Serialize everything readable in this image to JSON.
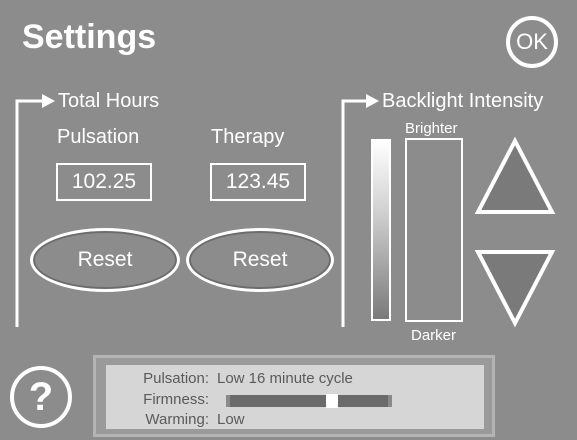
{
  "header": {
    "title": "Settings",
    "ok_label": "OK"
  },
  "total_hours": {
    "label": "Total Hours",
    "pulsation": {
      "label": "Pulsation",
      "value": "102.25",
      "reset_label": "Reset"
    },
    "therapy": {
      "label": "Therapy",
      "value": "123.45",
      "reset_label": "Reset"
    }
  },
  "backlight": {
    "label": "Backlight Intensity",
    "brighter_label": "Brighter",
    "darker_label": "Darker"
  },
  "help": {
    "label": "?"
  },
  "status": {
    "pulsation_key": "Pulsation:",
    "pulsation_value": "Low  16 minute cycle",
    "firmness_key": "Firmness:",
    "firmness_level": 0.65,
    "warming_key": "Warming:",
    "warming_value": "Low"
  },
  "colors": {
    "background": "#8c8c8c",
    "foreground": "#ffffff",
    "status_panel": "#d6d6d6"
  }
}
